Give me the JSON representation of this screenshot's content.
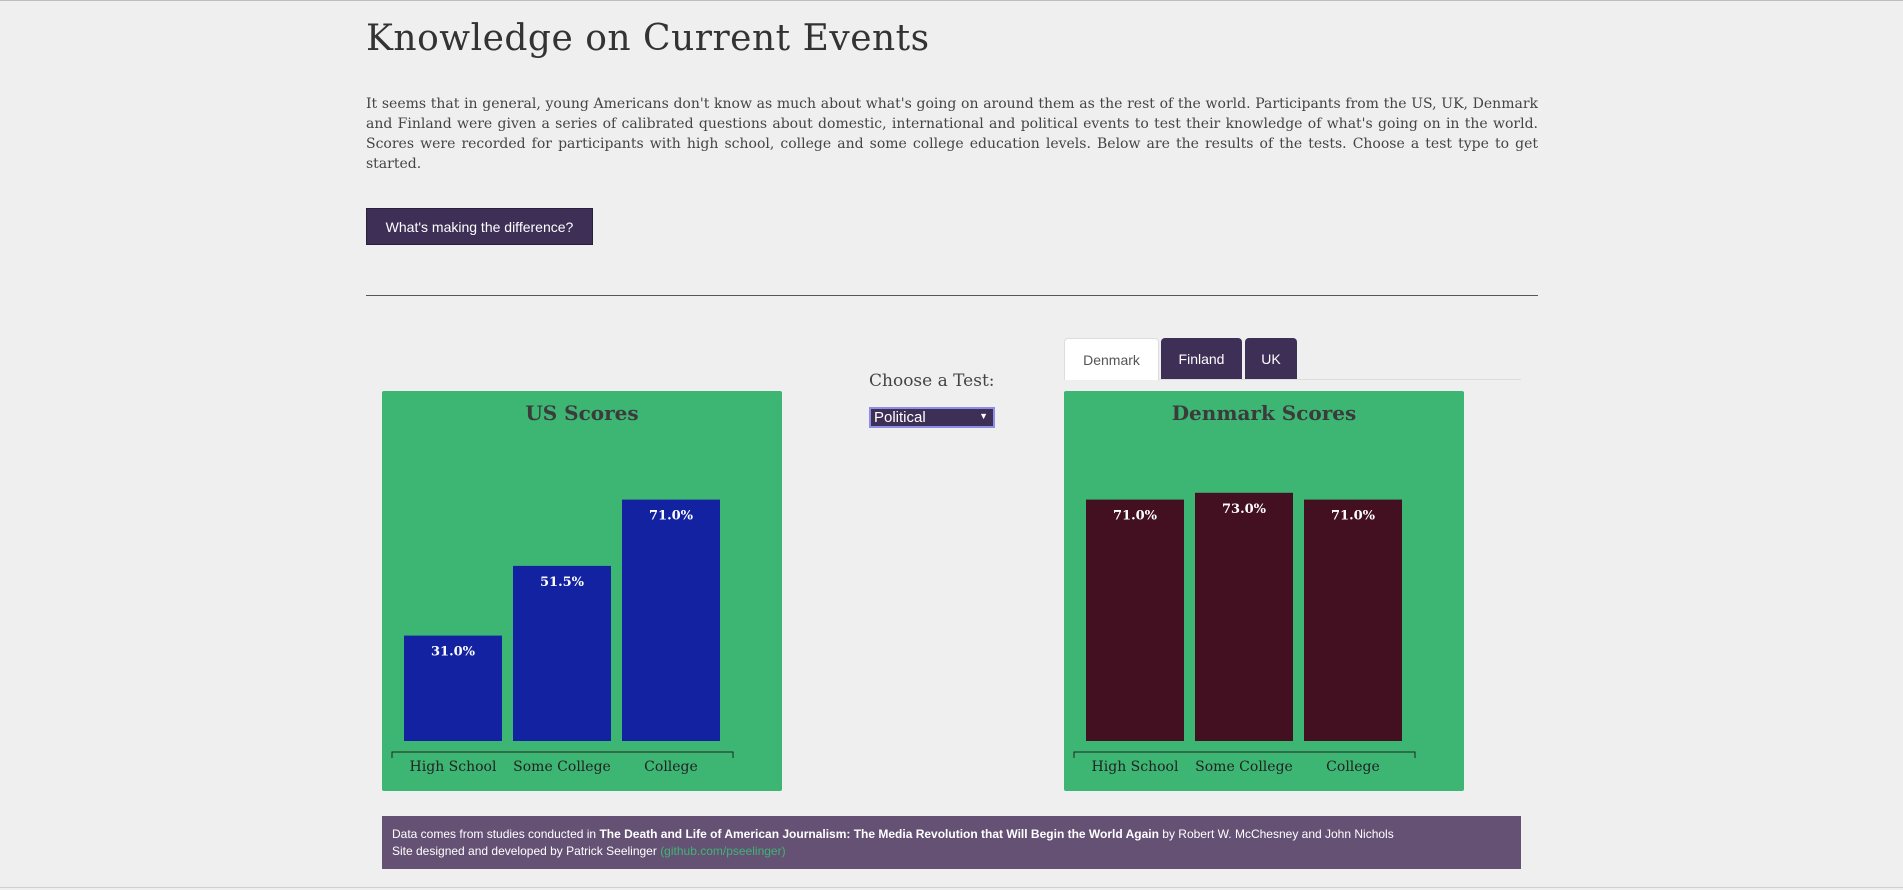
{
  "page": {
    "title": "Knowledge on Current Events",
    "intro": "It seems that in general, young Americans don't know as much about what's going on around them as the rest of the world. Participants from the US, UK, Denmark and Finland were given a series of calibrated questions about domestic, international and political events to test their knowledge of what's going on in the world. Scores were recorded for participants with high school, college and some college education levels. Below are the results of the tests. Choose a test type to get started.",
    "difference_button": "What's making the difference?"
  },
  "controls": {
    "choose_label": "Choose a Test:",
    "selected_test": "Political"
  },
  "tabs": [
    {
      "label": "Denmark",
      "active": true
    },
    {
      "label": "Finland",
      "active": false
    },
    {
      "label": "UK",
      "active": false
    }
  ],
  "chart_data": [
    {
      "type": "bar",
      "title": "US Scores",
      "categories": [
        "High School",
        "Some College",
        "College"
      ],
      "values": [
        31.0,
        51.5,
        71.0
      ],
      "value_labels": [
        "31.0%",
        "51.5%",
        "71.0%"
      ],
      "bar_color": "#1222a0",
      "ylim": [
        0,
        100
      ]
    },
    {
      "type": "bar",
      "title": "Denmark Scores",
      "categories": [
        "High School",
        "Some College",
        "College"
      ],
      "values": [
        71.0,
        73.0,
        71.0
      ],
      "value_labels": [
        "71.0%",
        "73.0%",
        "71.0%"
      ],
      "bar_color": "#421020",
      "ylim": [
        0,
        100
      ]
    }
  ],
  "footer": {
    "line1_prefix": "Data comes from studies conducted in ",
    "book_title": "The Death and Life of American Journalism: The Media Revolution that Will Begin the World Again",
    "line1_suffix": " by Robert W. McChesney and John Nichols",
    "line2": "Site designed and developed by Patrick Seelinger ",
    "github": "(github.com/pseelinger)"
  },
  "colors": {
    "accent": "#3e2f56",
    "panel": "#3db573",
    "footer": "#655174"
  }
}
